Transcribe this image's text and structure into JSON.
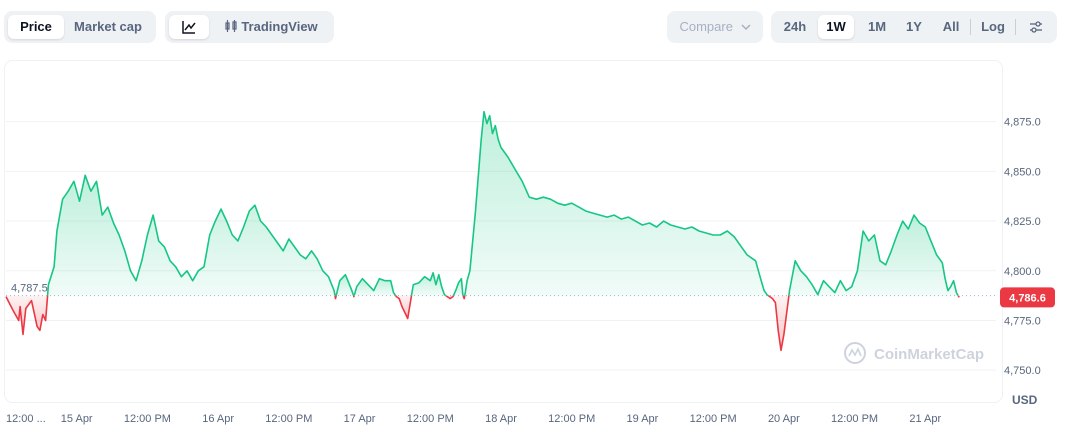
{
  "toolbar": {
    "price_label": "Price",
    "market_cap_label": "Market cap",
    "tradingview_label": "TradingView",
    "compare_label": "Compare",
    "ranges": [
      "24h",
      "1W",
      "1M",
      "1Y",
      "All"
    ],
    "active_range": "1W",
    "log_label": "Log",
    "icons": {
      "line": "line-chart-icon",
      "candles": "candlestick-icon",
      "chevron": "chevron-down-icon",
      "settings": "sliders-icon"
    }
  },
  "watermark": "CoinMarketCap",
  "currency": "USD",
  "colors": {
    "up": "#16c784",
    "down": "#ea3943",
    "up_fill": "#16c784",
    "down_fill": "#ea3943",
    "grid": "#eff2f5"
  },
  "chart_data": {
    "type": "area",
    "reference_price": 4787.5,
    "reference_label": "4,787.5",
    "current_price": 4786.6,
    "current_label": "4,786.6",
    "ylim": [
      4735,
      4905
    ],
    "yticks": [
      4750,
      4775,
      4800,
      4825,
      4850,
      4875
    ],
    "yticklabels": [
      "4,750.0",
      "4,775.0",
      "4,800.0",
      "4,825.0",
      "4,850.0",
      "4,875.0"
    ],
    "xlim": [
      0,
      7
    ],
    "xticks": [
      0,
      0.5,
      1,
      1.5,
      2,
      2.5,
      3,
      3.5,
      4,
      4.5,
      5,
      5.5,
      6,
      6.5
    ],
    "xticklabels": [
      "12:00 ...",
      "15 Apr",
      "12:00 PM",
      "16 Apr",
      "12:00 PM",
      "17 Apr",
      "12:00 PM",
      "18 Apr",
      "12:00 PM",
      "19 Apr",
      "12:00 PM",
      "20 Apr",
      "12:00 PM",
      "21 Apr"
    ],
    "x": [
      0,
      0.05,
      0.09,
      0.1,
      0.12,
      0.14,
      0.18,
      0.22,
      0.24,
      0.26,
      0.28,
      0.3,
      0.34,
      0.36,
      0.4,
      0.44,
      0.48,
      0.52,
      0.56,
      0.6,
      0.64,
      0.68,
      0.72,
      0.76,
      0.8,
      0.84,
      0.88,
      0.92,
      0.96,
      1.0,
      1.04,
      1.08,
      1.12,
      1.16,
      1.2,
      1.24,
      1.28,
      1.32,
      1.36,
      1.4,
      1.44,
      1.48,
      1.52,
      1.56,
      1.6,
      1.64,
      1.68,
      1.72,
      1.76,
      1.8,
      1.84,
      1.88,
      1.92,
      1.96,
      2.0,
      2.04,
      2.08,
      2.12,
      2.16,
      2.2,
      2.24,
      2.28,
      2.32,
      2.33,
      2.36,
      2.4,
      2.44,
      2.46,
      2.48,
      2.52,
      2.56,
      2.6,
      2.64,
      2.68,
      2.72,
      2.74,
      2.76,
      2.78,
      2.8,
      2.84,
      2.88,
      2.92,
      2.96,
      3.0,
      3.02,
      3.04,
      3.06,
      3.08,
      3.1,
      3.14,
      3.16,
      3.18,
      3.2,
      3.22,
      3.23,
      3.24,
      3.25,
      3.26,
      3.28,
      3.32,
      3.36,
      3.38,
      3.4,
      3.42,
      3.44,
      3.46,
      3.48,
      3.5,
      3.55,
      3.6,
      3.65,
      3.7,
      3.75,
      3.8,
      3.85,
      3.9,
      3.95,
      4.0,
      4.05,
      4.1,
      4.15,
      4.2,
      4.25,
      4.3,
      4.35,
      4.4,
      4.45,
      4.5,
      4.55,
      4.6,
      4.65,
      4.7,
      4.75,
      4.8,
      4.85,
      4.9,
      4.95,
      5.0,
      5.05,
      5.1,
      5.15,
      5.2,
      5.24,
      5.28,
      5.3,
      5.32,
      5.34,
      5.36,
      5.38,
      5.4,
      5.42,
      5.44,
      5.46,
      5.48,
      5.5,
      5.54,
      5.58,
      5.62,
      5.66,
      5.7,
      5.74,
      5.78,
      5.82,
      5.86,
      5.9,
      5.94,
      5.98,
      6.02,
      6.06,
      6.1,
      6.14,
      6.18,
      6.22,
      6.26,
      6.3,
      6.34,
      6.38,
      6.42,
      6.46,
      6.5,
      6.54,
      6.58,
      6.62,
      6.64,
      6.66,
      6.68,
      6.7,
      6.72,
      6.74
    ],
    "y": [
      4787,
      4780,
      4775,
      4782,
      4768,
      4781,
      4785,
      4772,
      4770,
      4778,
      4775,
      4793,
      4802,
      4820,
      4836,
      4840,
      4845,
      4835,
      4848,
      4840,
      4845,
      4828,
      4832,
      4824,
      4818,
      4810,
      4800,
      4795,
      4805,
      4818,
      4828,
      4815,
      4812,
      4805,
      4802,
      4797,
      4800,
      4795,
      4800,
      4802,
      4818,
      4825,
      4831,
      4825,
      4818,
      4815,
      4822,
      4830,
      4833,
      4825,
      4822,
      4818,
      4814,
      4810,
      4816,
      4812,
      4808,
      4806,
      4810,
      4806,
      4800,
      4797,
      4790,
      4786,
      4795,
      4798,
      4791,
      4787,
      4792,
      4796,
      4793,
      4790,
      4796,
      4795,
      4795,
      4789,
      4787,
      4786,
      4782,
      4776,
      4793,
      4794,
      4797,
      4795,
      4799,
      4793,
      4798,
      4792,
      4788,
      4786,
      4787,
      4790,
      4794,
      4796,
      4788,
      4786,
      4790,
      4795,
      4800,
      4830,
      4866,
      4880,
      4874,
      4878,
      4869,
      4873,
      4866,
      4862,
      4857,
      4851,
      4845,
      4837,
      4836,
      4837,
      4836,
      4834,
      4833,
      4834,
      4832,
      4830,
      4829,
      4828,
      4827,
      4828,
      4826,
      4827,
      4825,
      4823,
      4824,
      4822,
      4825,
      4823,
      4822,
      4821,
      4822,
      4820,
      4819,
      4818,
      4818,
      4820,
      4817,
      4812,
      4808,
      4806,
      4805,
      4800,
      4795,
      4790,
      4788,
      4787,
      4786,
      4784,
      4770,
      4760,
      4768,
      4790,
      4805,
      4800,
      4797,
      4793,
      4788,
      4795,
      4792,
      4789,
      4795,
      4790,
      4792,
      4800,
      4820,
      4815,
      4818,
      4805,
      4803,
      4810,
      4818,
      4825,
      4821,
      4828,
      4824,
      4822,
      4815,
      4808,
      4804,
      4796,
      4790,
      4792,
      4795,
      4789,
      4786.6
    ]
  }
}
